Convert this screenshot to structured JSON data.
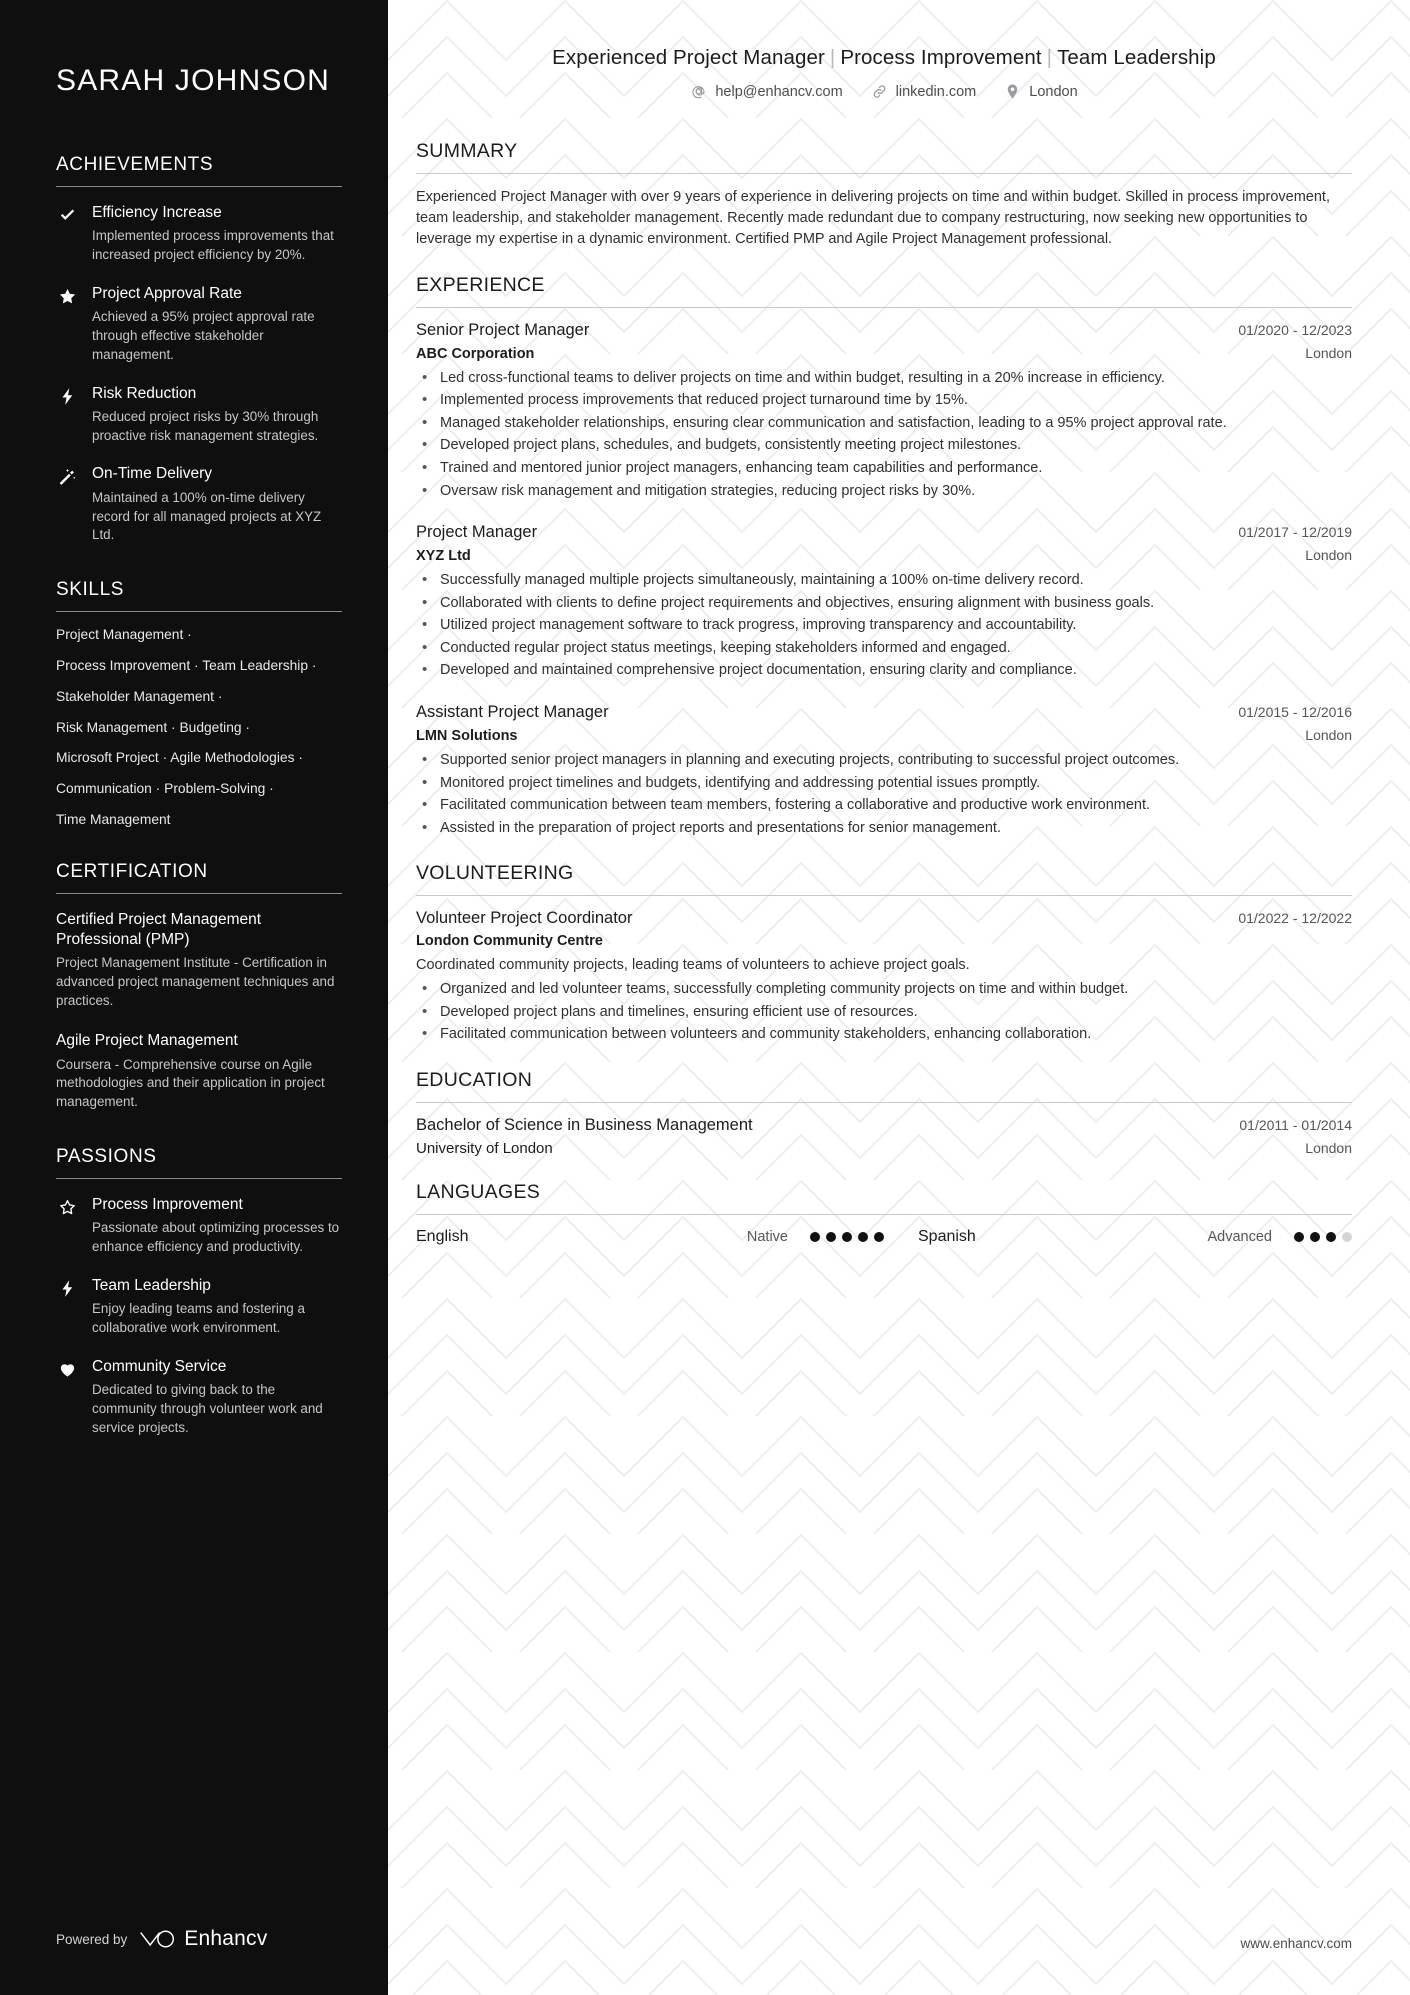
{
  "sidebar": {
    "name": "SARAH JOHNSON",
    "achievements": {
      "title": "ACHIEVEMENTS",
      "items": [
        {
          "icon": "check-icon",
          "title": "Efficiency Increase",
          "desc": "Implemented process improvements that increased project efficiency by 20%."
        },
        {
          "icon": "star-filled-icon",
          "title": "Project Approval Rate",
          "desc": "Achieved a 95% project approval rate through effective stakeholder management."
        },
        {
          "icon": "lightning-bolt-icon",
          "title": "Risk Reduction",
          "desc": "Reduced project risks by 30% through proactive risk management strategies."
        },
        {
          "icon": "magic-wand-icon",
          "title": "On-Time Delivery",
          "desc": "Maintained a 100% on-time delivery record for all managed projects at XYZ Ltd."
        }
      ]
    },
    "skills": {
      "title": "SKILLS",
      "lines": [
        "Project Management ·",
        "Process Improvement · Team Leadership ·",
        "Stakeholder Management ·",
        "Risk Management · Budgeting ·",
        "Microsoft Project · Agile Methodologies ·",
        "Communication · Problem-Solving ·",
        "Time Management"
      ]
    },
    "certification": {
      "title": "CERTIFICATION",
      "items": [
        {
          "name": "Certified Project Management Professional (PMP)",
          "desc": "Project Management Institute - Certification in advanced project management techniques and practices."
        },
        {
          "name": "Agile Project Management",
          "desc": "Coursera - Comprehensive course on Agile methodologies and their application in project management."
        }
      ]
    },
    "passions": {
      "title": "PASSIONS",
      "items": [
        {
          "icon": "star-outline-icon",
          "title": "Process Improvement",
          "desc": "Passionate about optimizing processes to enhance efficiency and productivity."
        },
        {
          "icon": "lightning-bolt-icon",
          "title": "Team Leadership",
          "desc": "Enjoy leading teams and fostering a collaborative work environment."
        },
        {
          "icon": "heart-icon",
          "title": "Community Service",
          "desc": "Dedicated to giving back to the community through volunteer work and service projects."
        }
      ]
    },
    "footer": {
      "powered_by": "Powered by",
      "brand": "Enhancv"
    }
  },
  "main": {
    "headline_parts": [
      "Experienced Project Manager",
      "Process Improvement",
      "Team Leadership"
    ],
    "headline_separator": "|",
    "contacts": [
      {
        "icon": "email-at-icon",
        "text": "help@enhancv.com"
      },
      {
        "icon": "link-icon",
        "text": "linkedin.com"
      },
      {
        "icon": "location-pin-icon",
        "text": "London"
      }
    ],
    "summary": {
      "title": "SUMMARY",
      "text": "Experienced Project Manager with over 9 years of experience in delivering projects on time and within budget. Skilled in process improvement, team leadership, and stakeholder management. Recently made redundant due to company restructuring, now seeking new opportunities to leverage my expertise in a dynamic environment. Certified PMP and Agile Project Management professional."
    },
    "experience": {
      "title": "EXPERIENCE",
      "jobs": [
        {
          "title": "Senior Project Manager",
          "date": "01/2020 - 12/2023",
          "company": "ABC Corporation",
          "location": "London",
          "bullets": [
            "Led cross-functional teams to deliver projects on time and within budget, resulting in a 20% increase in efficiency.",
            "Implemented process improvements that reduced project turnaround time by 15%.",
            "Managed stakeholder relationships, ensuring clear communication and satisfaction, leading to a 95% project approval rate.",
            "Developed project plans, schedules, and budgets, consistently meeting project milestones.",
            "Trained and mentored junior project managers, enhancing team capabilities and performance.",
            "Oversaw risk management and mitigation strategies, reducing project risks by 30%."
          ]
        },
        {
          "title": "Project Manager",
          "date": "01/2017 - 12/2019",
          "company": "XYZ Ltd",
          "location": "London",
          "bullets": [
            "Successfully managed multiple projects simultaneously, maintaining a 100% on-time delivery record.",
            "Collaborated with clients to define project requirements and objectives, ensuring alignment with business goals.",
            "Utilized project management software to track progress, improving transparency and accountability.",
            "Conducted regular project status meetings, keeping stakeholders informed and engaged.",
            "Developed and maintained comprehensive project documentation, ensuring clarity and compliance."
          ]
        },
        {
          "title": "Assistant Project Manager",
          "date": "01/2015 - 12/2016",
          "company": "LMN Solutions",
          "location": "London",
          "bullets": [
            "Supported senior project managers in planning and executing projects, contributing to successful project outcomes.",
            "Monitored project timelines and budgets, identifying and addressing potential issues promptly.",
            "Facilitated communication between team members, fostering a collaborative and productive work environment.",
            "Assisted in the preparation of project reports and presentations for senior management."
          ]
        }
      ]
    },
    "volunteering": {
      "title": "VOLUNTEERING",
      "entries": [
        {
          "title": "Volunteer Project Coordinator",
          "date": "01/2022 - 12/2022",
          "organization": "London Community Centre",
          "note": "Coordinated community projects, leading teams of volunteers to achieve project goals.",
          "bullets": [
            "Organized and led volunteer teams, successfully completing community projects on time and within budget.",
            "Developed project plans and timelines, ensuring efficient use of resources.",
            "Facilitated communication between volunteers and community stakeholders, enhancing collaboration."
          ]
        }
      ]
    },
    "education": {
      "title": "EDUCATION",
      "entries": [
        {
          "degree": "Bachelor of Science in Business Management",
          "date": "01/2011 - 01/2014",
          "school": "University of London",
          "location": "London"
        }
      ]
    },
    "languages": {
      "title": "LANGUAGES",
      "items": [
        {
          "name": "English",
          "level": "Native",
          "filled": 5,
          "total": 5
        },
        {
          "name": "Spanish",
          "level": "Advanced",
          "filled": 3,
          "total": 4
        }
      ]
    },
    "footer_url": "www.enhancv.com"
  },
  "theme": {
    "sidebar_bg": "#0f0f10",
    "main_bg": "#ffffff",
    "text_dark": "#1c1c1e",
    "text_muted": "#55555a",
    "pattern_color": "#e8e8ea"
  }
}
